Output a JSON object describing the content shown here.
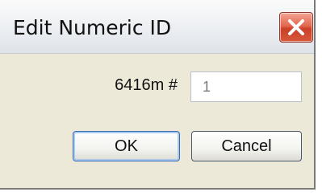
{
  "dialog": {
    "title": "Edit Numeric ID",
    "close_icon": "close-icon"
  },
  "form": {
    "label": "6416m #",
    "input_value": "1"
  },
  "buttons": {
    "ok_label": "OK",
    "cancel_label": "Cancel"
  },
  "colors": {
    "dialog_background": "#ece9d8",
    "close_button": "#d8583b",
    "ok_focus_border": "#3c6cb0"
  }
}
